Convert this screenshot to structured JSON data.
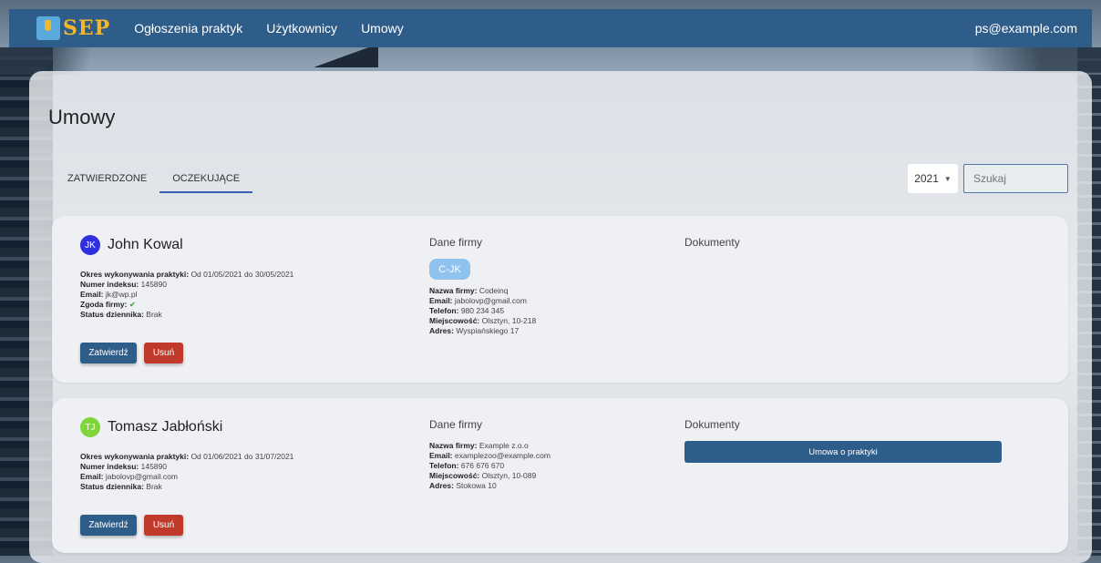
{
  "nav": {
    "logo_text": "SEP",
    "links": [
      "Ogłoszenia praktyk",
      "Użytkownicy",
      "Umowy"
    ],
    "user_email": "ps@example.com"
  },
  "page": {
    "title": "Umowy",
    "tabs": [
      {
        "label": "ZATWIERDZONE",
        "active": false
      },
      {
        "label": "OCZEKUJĄCE",
        "active": true
      }
    ],
    "year_selected": "2021",
    "search_placeholder": "Szukaj"
  },
  "labels": {
    "period": "Okres wykonywania praktyki:",
    "index": "Numer indeksu:",
    "email": "Email:",
    "consent": "Zgoda firmy:",
    "journal": "Status dziennika:",
    "company_section": "Dane firmy",
    "documents_section": "Dokumenty",
    "company_name": "Nazwa firmy:",
    "phone": "Telefon:",
    "city": "Miejscowość:",
    "address": "Adres:",
    "approve": "Zatwierdź",
    "delete": "Usuń"
  },
  "contracts": [
    {
      "initials": "JK",
      "avatar_color": "#2f2fe0",
      "name": "John Kowal",
      "period": "Od 01/05/2021 do 30/05/2021",
      "index": "145890",
      "email": "jk@wp.pl",
      "consent": "✔",
      "journal": "Brak",
      "company_badge": "C-JK",
      "company_name": "Codeinq",
      "company_email": "jabolovp@gmail.com",
      "company_phone": "980 234 345",
      "company_city": "Olsztyn, 10-218",
      "company_address": "Wyspiańskiego 17",
      "document": ""
    },
    {
      "initials": "TJ",
      "avatar_color": "#7fd63a",
      "name": "Tomasz Jabłoński",
      "period": "Od 01/06/2021 do 31/07/2021",
      "index": "145890",
      "email": "jabolovp@gmail.com",
      "journal": "Brak",
      "company_name": "Example z.o.o",
      "company_email": "examplezoo@example.com",
      "company_phone": "676 676 670",
      "company_city": "Olsztyn, 10-089",
      "company_address": "Stokowa 10",
      "document": "Umowa o praktyki"
    }
  ]
}
